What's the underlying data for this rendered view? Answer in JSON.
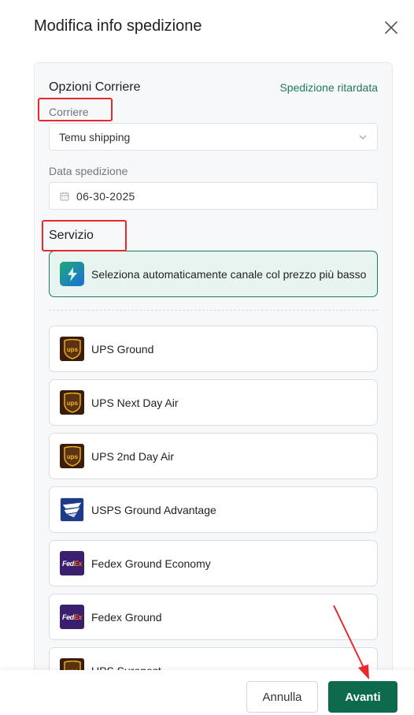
{
  "dialog": {
    "title": "Modifica info spedizione",
    "close_icon": "close-icon"
  },
  "carrier_options": {
    "section_title": "Opzioni Corriere",
    "delayed_link": "Spedizione ritardata",
    "carrier_label": "Corriere",
    "carrier_value": "Temu shipping",
    "date_label": "Data spedizione",
    "date_value": "06-30-2025"
  },
  "service": {
    "section_title": "Servizio",
    "auto_option": "Seleziona automaticamente canale col prezzo più basso",
    "options": [
      {
        "name": "UPS Ground",
        "logo": "ups-logo"
      },
      {
        "name": "UPS Next Day Air",
        "logo": "ups-logo"
      },
      {
        "name": "UPS 2nd Day Air",
        "logo": "ups-logo"
      },
      {
        "name": "USPS Ground Advantage",
        "logo": "usps-logo"
      },
      {
        "name": "Fedex Ground Economy",
        "logo": "fedex-logo"
      },
      {
        "name": "Fedex Ground",
        "logo": "fedex-logo"
      },
      {
        "name": "UPS Surepost",
        "logo": "ups-logo"
      }
    ]
  },
  "logos": {
    "ups_text": "ups",
    "fedex_fe": "Fed",
    "fedex_ex": "Ex"
  },
  "footer": {
    "cancel_label": "Annulla",
    "next_label": "Avanti"
  },
  "colors": {
    "accent": "#0e6a4c",
    "link": "#1e7a5a",
    "highlight": "#e8282b",
    "auto_bg": "#e8f4ef"
  }
}
